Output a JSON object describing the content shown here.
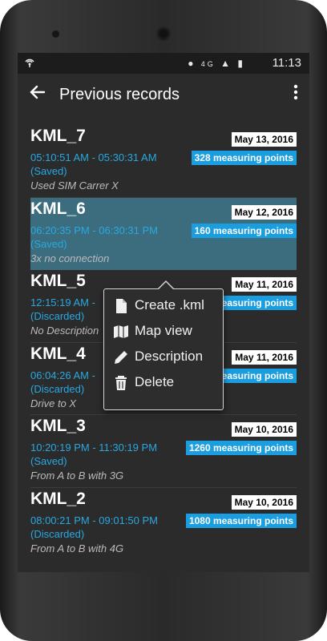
{
  "status_bar": {
    "left_icon": "wifi-broadcast-icon",
    "icons": [
      "location-icon",
      "4g-icon",
      "signal-icon",
      "battery-icon"
    ],
    "time": "11:13"
  },
  "app_bar": {
    "title": "Previous records",
    "back_icon": "arrow-left-icon",
    "menu_icon": "more-vert-icon"
  },
  "records": [
    {
      "name": "KML_7",
      "time": "05:10:51 AM - 05:30:31 AM",
      "status": "(Saved)",
      "description": "Used SIM Carrer X",
      "date": "May 13, 2016",
      "points": "328 measuring points",
      "selected": false
    },
    {
      "name": "KML_6",
      "time": "06:20:35 PM - 06:30:31 PM",
      "status": "(Saved)",
      "description": "3x no connection",
      "date": "May 12, 2016",
      "points": "160 measuring points",
      "selected": true
    },
    {
      "name": "KML_5",
      "time": "12:15:19 AM - ",
      "status": "(Discarded)",
      "description": "No Description",
      "date": "May 11, 2016",
      "points": "measuring points",
      "selected": false
    },
    {
      "name": "KML_4",
      "time": "06:04:26 AM - ",
      "status": "(Discarded)",
      "description": "Drive to X",
      "date": "May 11, 2016",
      "points": "measuring points",
      "selected": false
    },
    {
      "name": "KML_3",
      "time": "10:20:19 PM - 11:30:19 PM",
      "status": "(Saved)",
      "description": "From A to B with 3G",
      "date": "May 10, 2016",
      "points": "1260 measuring points",
      "selected": false
    },
    {
      "name": "KML_2",
      "time": "08:00:21 PM - 09:01:50 PM",
      "status": "(Discarded)",
      "description": "From A to B with 4G",
      "date": "May 10, 2016",
      "points": "1080 measuring points",
      "selected": false
    }
  ],
  "context_menu": {
    "items": [
      {
        "label": "Create .kml",
        "icon": "file-icon"
      },
      {
        "label": "Map view",
        "icon": "map-icon"
      },
      {
        "label": "Description",
        "icon": "pencil-icon"
      },
      {
        "label": "Delete",
        "icon": "trash-icon"
      }
    ]
  },
  "colors": {
    "accent": "#29a8e0",
    "selected_row": "#3b6d7e",
    "points_badge": "#1a9ee0",
    "background": "#2b2b2b"
  }
}
